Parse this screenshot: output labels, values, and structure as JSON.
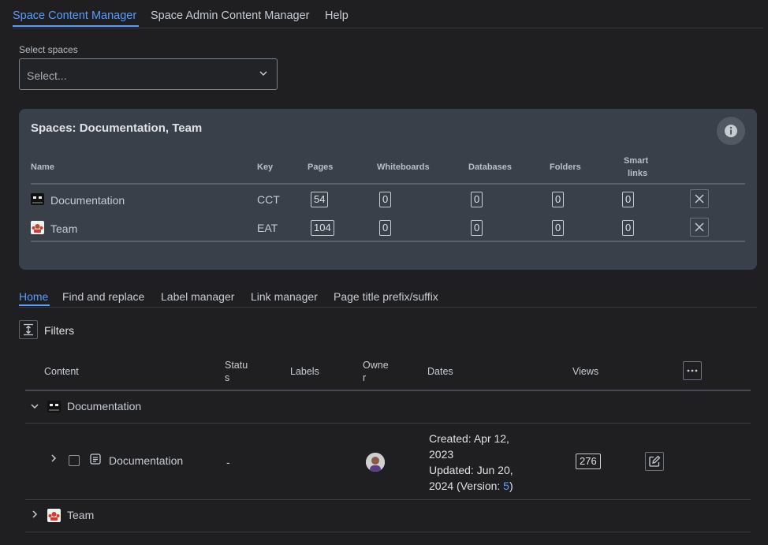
{
  "top_tabs": {
    "items": [
      "Space Content Manager",
      "Space Admin Content Manager",
      "Help"
    ]
  },
  "space_select": {
    "label": "Select spaces",
    "placeholder": "Select..."
  },
  "spaces_panel": {
    "title": "Spaces: Documentation, Team",
    "headers": {
      "name": "Name",
      "key": "Key",
      "pages": "Pages",
      "whiteboards": "Whiteboards",
      "databases": "Databases",
      "folders": "Folders",
      "smart_links_line1": "Smart",
      "smart_links_line2": "links"
    },
    "rows": [
      {
        "name": "Documentation",
        "key": "CCT",
        "pages": "54",
        "whiteboards": "0",
        "databases": "0",
        "folders": "0",
        "smart_links": "0"
      },
      {
        "name": "Team",
        "key": "EAT",
        "pages": "104",
        "whiteboards": "0",
        "databases": "0",
        "folders": "0",
        "smart_links": "0"
      }
    ]
  },
  "sub_tabs": {
    "items": [
      "Home",
      "Find and replace",
      "Label manager",
      "Link manager",
      "Page title prefix/suffix"
    ]
  },
  "filters": {
    "label": "Filters"
  },
  "content_table": {
    "headers": {
      "content": "Content",
      "status_1": "Statu",
      "status_2": "s",
      "labels": "Labels",
      "owner_1": "Owne",
      "owner_2": "r",
      "dates": "Dates",
      "views": "Views"
    },
    "groups": [
      {
        "name": "Documentation"
      },
      {
        "name": "Team"
      }
    ],
    "row": {
      "title": "Documentation",
      "status": "-",
      "created_1": "Created: Apr 12,",
      "created_2": "2023",
      "updated_1": "Updated: Jun 20,",
      "updated_2a": "2024 (Version: ",
      "version": "5",
      "updated_2b": ")",
      "views": "276"
    }
  },
  "colors": {
    "accent": "#579dff",
    "background": "#1f1f21",
    "panel": "#3a4049"
  }
}
